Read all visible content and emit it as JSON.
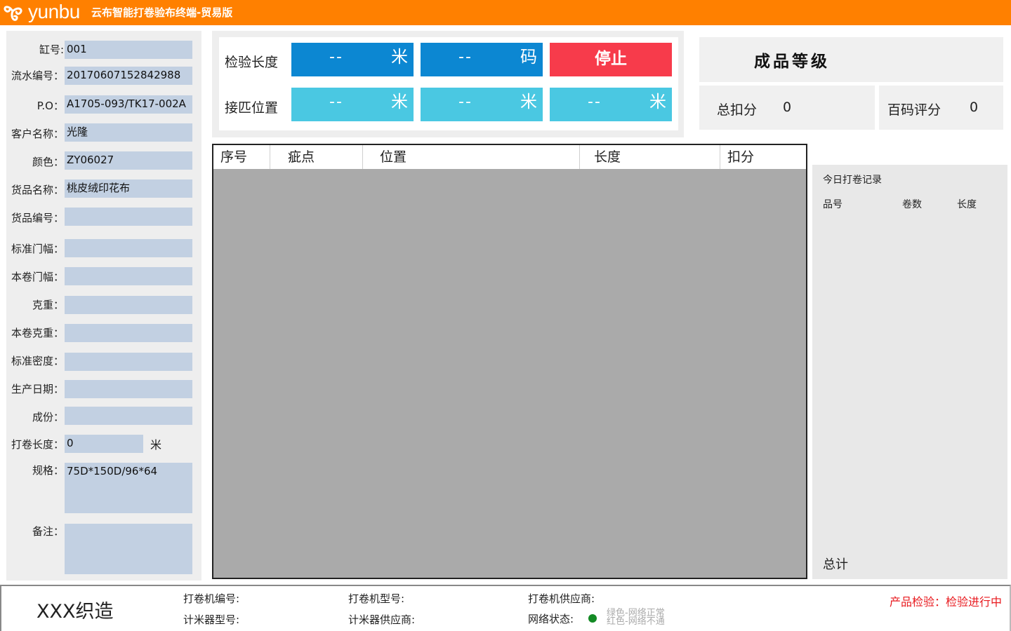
{
  "header": {
    "logo_text": "yunbu",
    "title": "云布智能打卷验布终端-贸易版"
  },
  "form": {
    "fields": [
      {
        "label": "缸号:",
        "value": "001"
      },
      {
        "label": "流水编号：",
        "value": "20170607152842988"
      },
      {
        "label": "P.O：",
        "value": "A1705-093/TK17-002A"
      },
      {
        "label": "客户名称：",
        "value": "光隆"
      },
      {
        "label": "颜色：",
        "value": "ZY06027"
      },
      {
        "label": "货品名称：",
        "value": "桃皮绒印花布"
      },
      {
        "label": "货品编号：",
        "value": ""
      },
      {
        "label": "标准门幅：",
        "value": ""
      },
      {
        "label": "本卷门幅：",
        "value": ""
      },
      {
        "label": "克重：",
        "value": ""
      },
      {
        "label": "本卷克重：",
        "value": ""
      },
      {
        "label": "标准密度：",
        "value": ""
      },
      {
        "label": "生产日期：",
        "value": ""
      },
      {
        "label": "成份：",
        "value": ""
      }
    ],
    "roll_length": {
      "label": "打卷长度：",
      "value": "0",
      "unit": "米"
    },
    "spec": {
      "label": "规格：",
      "value": "75D*150D/96*64"
    },
    "remark": {
      "label": "备注：",
      "value": ""
    }
  },
  "measure": {
    "inspect_label": "检验长度",
    "splice_label": "接匹位置",
    "inspect_m": {
      "value": "--",
      "unit": "米"
    },
    "inspect_yd": {
      "value": "--",
      "unit": "码"
    },
    "stop_label": "停止",
    "splice": [
      {
        "value": "--",
        "unit": "米"
      },
      {
        "value": "--",
        "unit": "米"
      },
      {
        "value": "--",
        "unit": "米"
      }
    ]
  },
  "grade": {
    "title": "成品等级",
    "total_deduct_label": "总扣分",
    "total_deduct_value": "0",
    "hundred_yard_label": "百码评分",
    "hundred_yard_value": "0"
  },
  "defect_table": {
    "columns": [
      "序号",
      "疵点",
      "位置",
      "长度",
      "扣分"
    ],
    "rows": []
  },
  "today_records": {
    "title": "今日打卷记录",
    "columns": [
      "品号",
      "卷数",
      "长度"
    ],
    "total_label": "总计"
  },
  "footer": {
    "company": "XXX织造",
    "roller_no_label": "打卷机编号:",
    "roller_model_label": "打卷机型号:",
    "roller_supplier_label": "打卷机供应商:",
    "meter_model_label": "计米器型号:",
    "meter_supplier_label": "计米器供应商:",
    "network_label": "网络状态:",
    "legend_green": "绿色-网络正常",
    "legend_red": "红色-网络不通",
    "inspect_status": "产品检验：检验进行中",
    "status_color": "#138a24"
  }
}
